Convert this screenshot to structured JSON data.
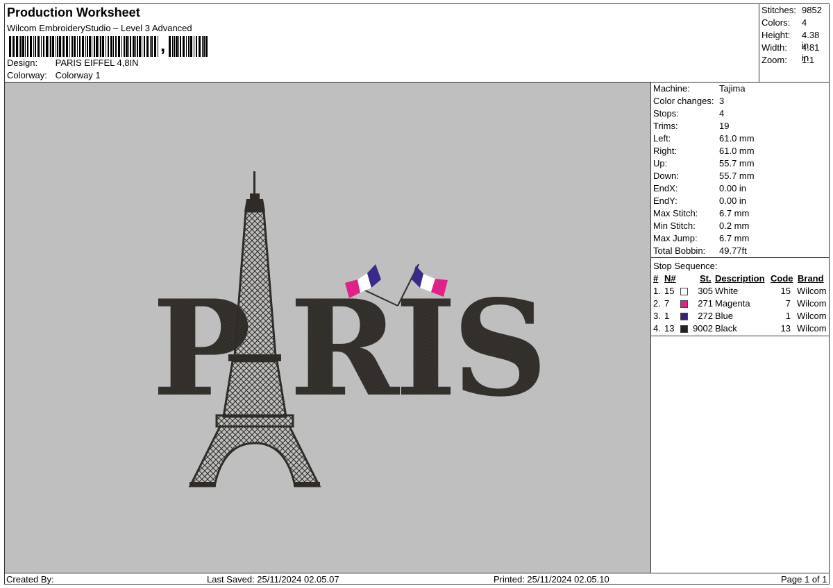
{
  "header": {
    "title": "Production Worksheet",
    "software": "Wilcom EmbroideryStudio – Level 3 Advanced",
    "barcode_text": ",",
    "design_label": "Design:",
    "design_value": "PARIS EIFFEL 4,8IN",
    "colorway_label": "Colorway:",
    "colorway_value": "Colorway 1"
  },
  "stats": {
    "stitches_label": "Stitches:",
    "stitches": "9852",
    "colors_label": "Colors:",
    "colors": "4",
    "height_label": "Height:",
    "height": "4.38 in",
    "width_label": "Width:",
    "width": "4.81 in",
    "zoom_label": "Zoom:",
    "zoom": "1:1"
  },
  "design": {
    "text": "PARIS",
    "thread_color": "#2f2c28",
    "flag_colors": [
      "#ffffff",
      "#e0218a",
      "#3a2a8a"
    ]
  },
  "machine": [
    {
      "label": "Machine:",
      "value": "Tajima"
    },
    {
      "label": "Color changes:",
      "value": "3"
    },
    {
      "label": "Stops:",
      "value": "4"
    },
    {
      "label": "Trims:",
      "value": "19"
    },
    {
      "label": "Left:",
      "value": "61.0 mm"
    },
    {
      "label": "Right:",
      "value": "61.0 mm"
    },
    {
      "label": "Up:",
      "value": "55.7 mm"
    },
    {
      "label": "Down:",
      "value": "55.7 mm"
    },
    {
      "label": "EndX:",
      "value": "0.00 in"
    },
    {
      "label": "EndY:",
      "value": "0.00 in"
    },
    {
      "label": "Max Stitch:",
      "value": "6.7 mm"
    },
    {
      "label": "Min Stitch:",
      "value": "0.2 mm"
    },
    {
      "label": "Max Jump:",
      "value": "6.7 mm"
    },
    {
      "label": "Total Bobbin:",
      "value": "49.77ft"
    }
  ],
  "stop_sequence": {
    "title": "Stop Sequence:",
    "headers": {
      "num": "#",
      "n": "N#",
      "st": "St.",
      "desc": "Description",
      "code": "Code",
      "brand": "Brand"
    },
    "rows": [
      {
        "num": "1.",
        "n": "15",
        "color": "#ffffff",
        "st": "305",
        "desc": "White",
        "code": "15",
        "brand": "Wilcom"
      },
      {
        "num": "2.",
        "n": "7",
        "color": "#e0218a",
        "st": "271",
        "desc": "Magenta",
        "code": "7",
        "brand": "Wilcom"
      },
      {
        "num": "3.",
        "n": "1",
        "color": "#33237a",
        "st": "272",
        "desc": "Blue",
        "code": "1",
        "brand": "Wilcom"
      },
      {
        "num": "4.",
        "n": "13",
        "color": "#222222",
        "st": "9002",
        "desc": "Black",
        "code": "13",
        "brand": "Wilcom"
      }
    ]
  },
  "footer": {
    "created_by": "Created By:",
    "last_saved": "Last Saved: 25/11/2024 02.05.07",
    "printed": "Printed: 25/11/2024 02.05.10",
    "page": "Page 1 of 1"
  }
}
